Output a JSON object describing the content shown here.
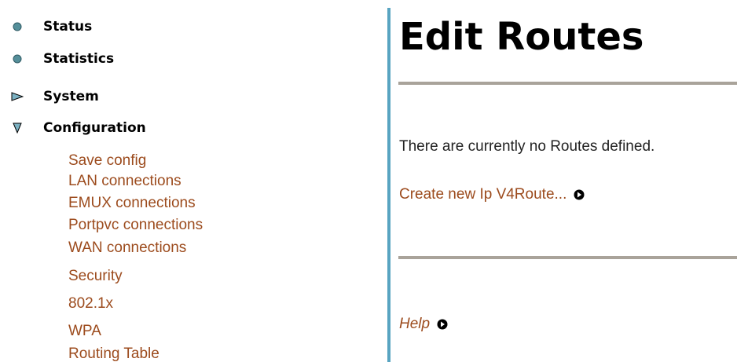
{
  "nav": {
    "main": [
      {
        "label": "Status",
        "icon": "bullet-icon"
      },
      {
        "label": "Statistics",
        "icon": "bullet-icon"
      },
      {
        "label": "System",
        "icon": "triangle-right-icon"
      },
      {
        "label": "Configuration",
        "icon": "triangle-down-icon"
      }
    ],
    "sub": [
      {
        "label": "Save config"
      },
      {
        "label": "LAN connections"
      },
      {
        "label": "EMUX connections"
      },
      {
        "label": "Portpvc connections"
      },
      {
        "label": "WAN connections"
      },
      {
        "label": "Security"
      },
      {
        "label": "802.1x"
      },
      {
        "label": "WPA"
      },
      {
        "label": "Routing Table"
      }
    ]
  },
  "main": {
    "title": "Edit Routes",
    "info": "There are currently no Routes defined.",
    "create_link": "Create new Ip V4Route...",
    "help_link": "Help"
  },
  "colors": {
    "link": "#9c4b1d",
    "divider": "#58a4c1",
    "rule": "#a9a39a",
    "bullet": "#558f9a"
  }
}
